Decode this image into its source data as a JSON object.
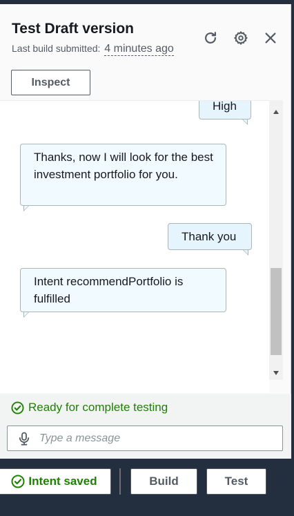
{
  "header": {
    "title": "Test Draft version",
    "subtitle_label": "Last build submitted:",
    "subtitle_time": "4 minutes ago",
    "inspect_label": "Inspect",
    "icons": [
      "refresh-icon",
      "gear-icon",
      "close-icon"
    ]
  },
  "chat": {
    "messages": [
      {
        "from": "user",
        "text": "High"
      },
      {
        "from": "bot",
        "text": "Thanks, now I will look for the best investment portfolio for you."
      },
      {
        "from": "user",
        "text": "Thank you"
      },
      {
        "from": "bot",
        "text": "Intent recommendPortfolio is fulfilled"
      }
    ]
  },
  "status": {
    "text": "Ready for complete testing",
    "color": "#1d8102"
  },
  "input": {
    "placeholder": "Type a message",
    "value": ""
  },
  "footer": {
    "saved_label": "Intent saved",
    "build_label": "Build",
    "test_label": "Test"
  },
  "colors": {
    "footer_bg": "#232f3e",
    "bubble_bg": "#f1faff",
    "success": "#1d8102"
  }
}
